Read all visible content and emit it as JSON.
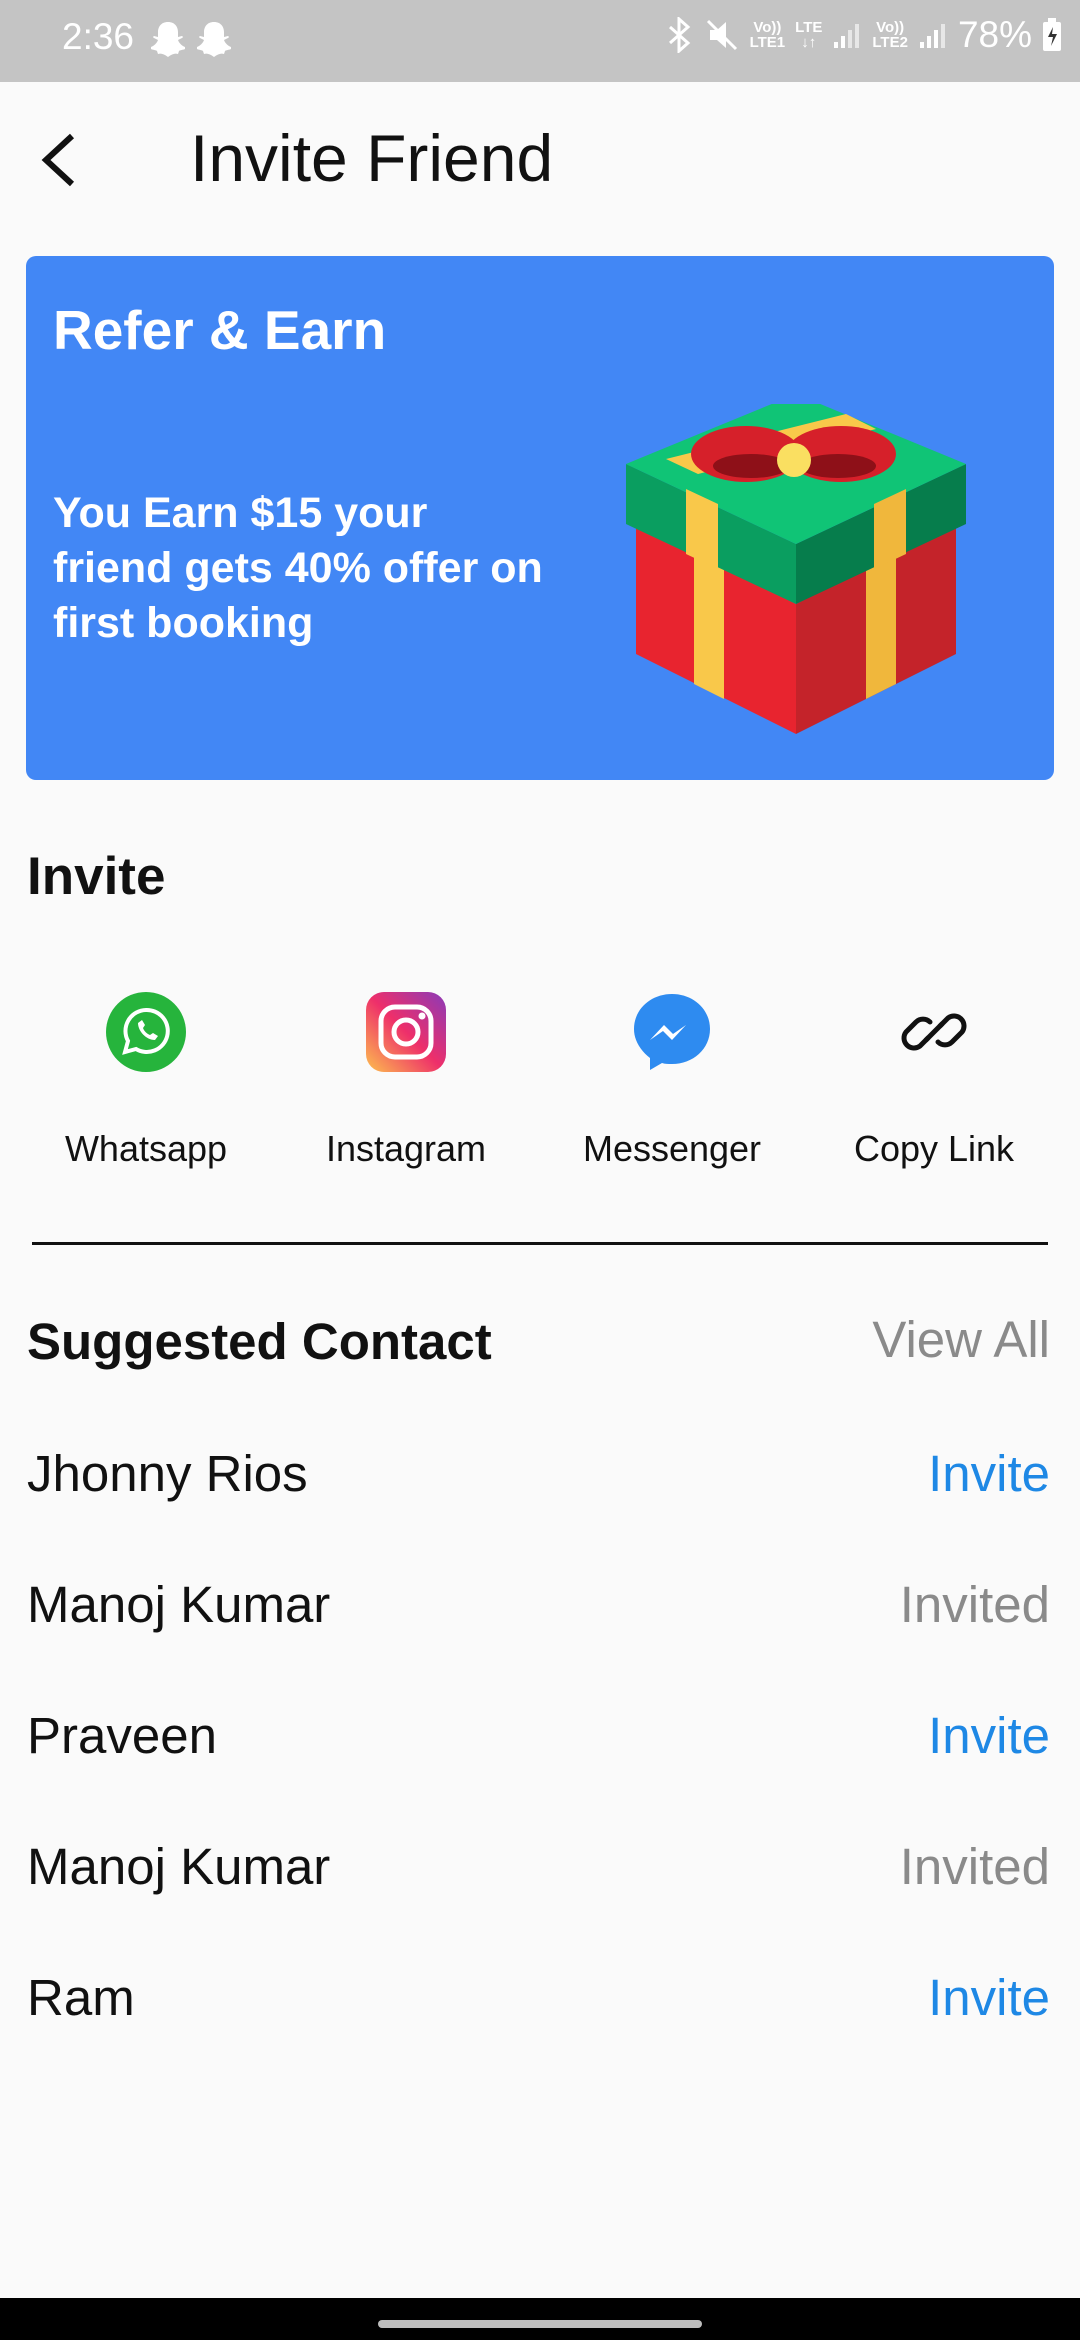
{
  "status_bar": {
    "time": "2:36",
    "net1_top": "Vo))",
    "net1_bottom": "LTE1",
    "lte_top": "LTE",
    "lte_bottom": "↓↑",
    "net2_top": "Vo))",
    "net2_bottom": "LTE2",
    "battery": "78%"
  },
  "app_bar": {
    "title": "Invite Friend"
  },
  "banner": {
    "title": "Refer & Earn",
    "text": "You Earn $15 your friend gets 40% offer on first booking",
    "background_color": "#4287f5"
  },
  "invite_section": {
    "heading": "Invite",
    "share_options": [
      {
        "label": "Whatsapp",
        "icon": "whatsapp-icon"
      },
      {
        "label": "Instagram",
        "icon": "instagram-icon"
      },
      {
        "label": "Messenger",
        "icon": "messenger-icon"
      },
      {
        "label": "Copy Link",
        "icon": "link-icon"
      }
    ]
  },
  "suggested": {
    "heading": "Suggested Contact",
    "view_all": "View All",
    "contacts": [
      {
        "name": "Jhonny Rios",
        "action": "Invite"
      },
      {
        "name": "Manoj Kumar",
        "action": "Invited"
      },
      {
        "name": "Praveen",
        "action": "Invite"
      },
      {
        "name": "Manoj Kumar",
        "action": "Invited"
      },
      {
        "name": "Ram",
        "action": "Invite"
      }
    ]
  },
  "colors": {
    "accent": "#1e88e5",
    "muted": "#8a8a8a"
  }
}
